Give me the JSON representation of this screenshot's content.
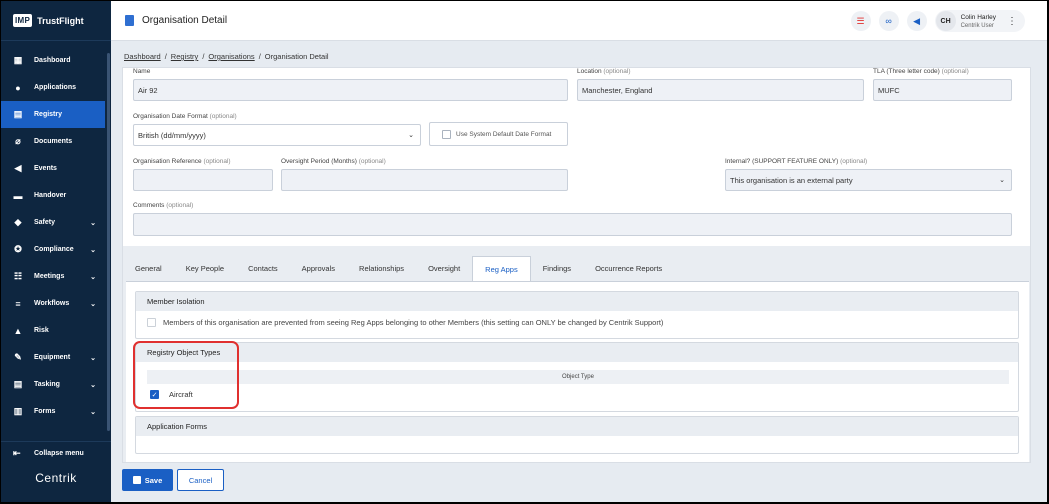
{
  "sidebar": {
    "brand": {
      "logo": "IMP",
      "name": "TrustFlight"
    },
    "items": [
      {
        "label": "Dashboard",
        "icon": "dashboard-icon",
        "glyph": "▦",
        "chevron": false
      },
      {
        "label": "Applications",
        "icon": "user-icon",
        "glyph": "●",
        "chevron": false
      },
      {
        "label": "Registry",
        "icon": "registry-icon",
        "glyph": "▤",
        "chevron": false,
        "active": true
      },
      {
        "label": "Documents",
        "icon": "paperclip-icon",
        "glyph": "⌀",
        "chevron": false
      },
      {
        "label": "Events",
        "icon": "megaphone-icon",
        "glyph": "◀",
        "chevron": false
      },
      {
        "label": "Handover",
        "icon": "handover-icon",
        "glyph": "▬",
        "chevron": false
      },
      {
        "label": "Safety",
        "icon": "shield-icon",
        "glyph": "◆",
        "chevron": true
      },
      {
        "label": "Compliance",
        "icon": "badge-icon",
        "glyph": "✪",
        "chevron": true
      },
      {
        "label": "Meetings",
        "icon": "meetings-icon",
        "glyph": "☷",
        "chevron": true
      },
      {
        "label": "Workflows",
        "icon": "workflow-icon",
        "glyph": "≡",
        "chevron": true
      },
      {
        "label": "Risk",
        "icon": "warning-icon",
        "glyph": "▲",
        "chevron": false
      },
      {
        "label": "Equipment",
        "icon": "wrench-icon",
        "glyph": "✎",
        "chevron": true
      },
      {
        "label": "Tasking",
        "icon": "tasking-icon",
        "glyph": "▤",
        "chevron": true
      },
      {
        "label": "Forms",
        "icon": "forms-icon",
        "glyph": "▥",
        "chevron": true
      }
    ],
    "collapse_label": "Collapse menu",
    "footer_logo": "Centrik"
  },
  "header": {
    "title": "Organisation Detail",
    "user_initials": "CH",
    "user_name": "Colin Harley",
    "user_role": "Centrik User"
  },
  "breadcrumb": {
    "items": [
      "Dashboard",
      "Registry",
      "Organisations"
    ],
    "current": "Organisation Detail",
    "separator": "/"
  },
  "form": {
    "name_label": "Name",
    "name_value": "Air 92",
    "location_label": "Location",
    "location_optional": "(optional)",
    "location_value": "Manchester, England",
    "tla_label": "TLA (Three letter code)",
    "tla_optional": "(optional)",
    "tla_value": "MUFC",
    "date_format_label": "Organisation Date Format",
    "date_format_optional": "(optional)",
    "date_format_value": "British (dd/mm/yyyy)",
    "system_default_label": "Use System Default Date Format",
    "reference_label": "Organisation Reference",
    "reference_optional": "(optional)",
    "reference_value": "",
    "oversight_label": "Oversight Period (Months)",
    "oversight_optional": "(optional)",
    "oversight_value": "",
    "internal_label": "Internal? (SUPPORT FEATURE ONLY)",
    "internal_optional": "(optional)",
    "internal_value": "This organisation is an external party",
    "comments_label": "Comments",
    "comments_optional": "(optional)",
    "comments_value": ""
  },
  "tabs": [
    "General",
    "Key People",
    "Contacts",
    "Approvals",
    "Relationships",
    "Oversight",
    "Reg Apps",
    "Findings",
    "Occurrence Reports"
  ],
  "active_tab": "Reg Apps",
  "reg_apps": {
    "member_isolation_title": "Member Isolation",
    "member_isolation_text": "Members of this organisation are prevented from seeing Reg Apps belonging to other Members (this setting can ONLY be changed by Centrik Support)",
    "member_isolation_checked": false,
    "object_types_title": "Registry Object Types",
    "object_type_col": "Object Type",
    "object_types": [
      {
        "label": "Aircraft",
        "checked": true
      }
    ],
    "application_forms_title": "Application Forms"
  },
  "buttons": {
    "save": "Save",
    "cancel": "Cancel"
  },
  "colors": {
    "sidebar_bg": "#0e2640",
    "accent": "#1a5fc4",
    "highlight": "#e0302f"
  }
}
